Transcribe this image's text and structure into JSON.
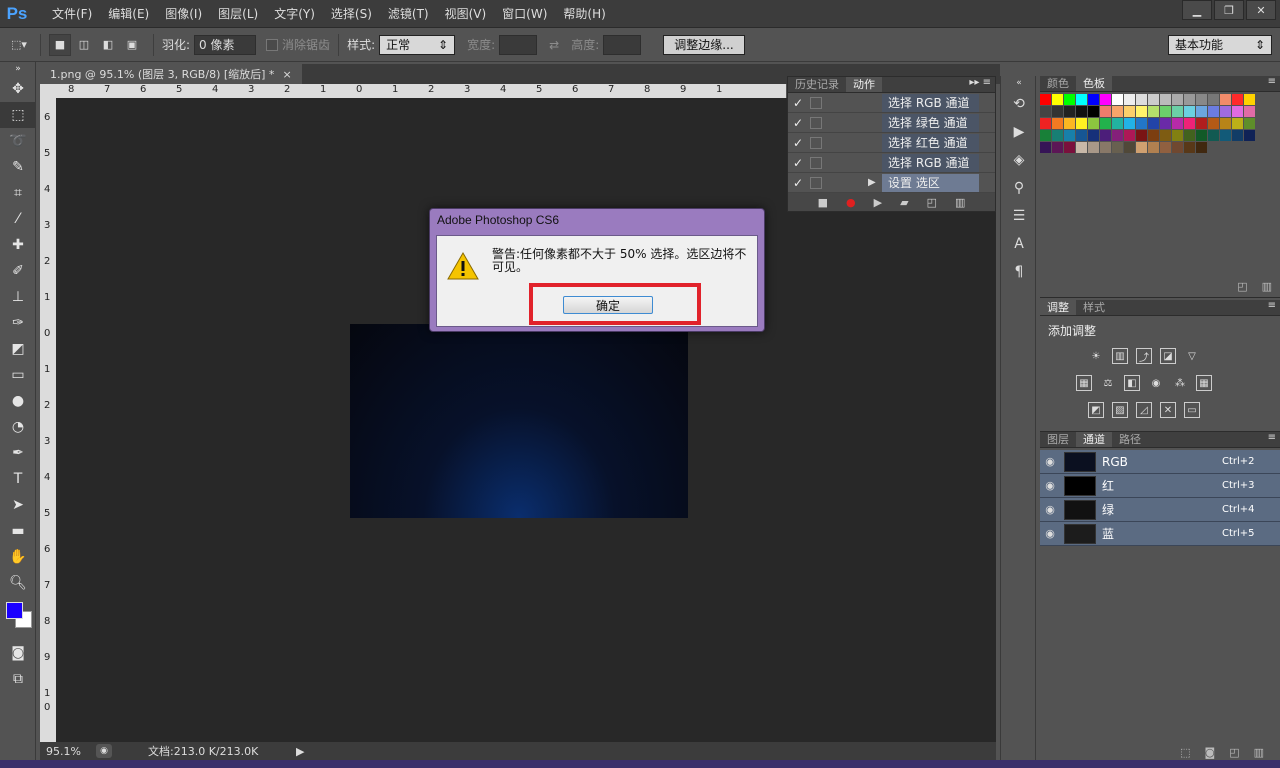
{
  "app": {
    "logo": "Ps"
  },
  "menu": [
    "文件(F)",
    "编辑(E)",
    "图像(I)",
    "图层(L)",
    "文字(Y)",
    "选择(S)",
    "滤镜(T)",
    "视图(V)",
    "窗口(W)",
    "帮助(H)"
  ],
  "window_controls": {
    "minimize": "▁",
    "restore": "❐",
    "close": "✕"
  },
  "options": {
    "feather_label": "羽化:",
    "feather_value": "0 像素",
    "antialias_label": "消除锯齿",
    "style_label": "样式:",
    "style_value": "正常",
    "width_label": "宽度:",
    "height_label": "高度:",
    "refine_edge": "调整边缘...",
    "workspace": "基本功能"
  },
  "document": {
    "tab_title": "1.png @ 95.1% (图层 3, RGB/8) [缩放后] *",
    "tab_close": "×",
    "zoom": "95.1%",
    "doc_size": "文档:213.0 K/213.0K"
  },
  "ruler_top": [
    "8",
    "7",
    "6",
    "5",
    "4",
    "3",
    "2",
    "1",
    "0",
    "1",
    "2",
    "3",
    "4",
    "5",
    "6",
    "7",
    "8",
    "9",
    "1"
  ],
  "ruler_left": [
    "6",
    "5",
    "4",
    "3",
    "2",
    "1",
    "0",
    "1",
    "2",
    "3",
    "4",
    "5",
    "6",
    "7",
    "8",
    "9",
    "1",
    "0"
  ],
  "actions_panel": {
    "tabs": [
      "历史记录",
      "动作"
    ],
    "rows": [
      {
        "check": "✓",
        "label": "选择 RGB 通道",
        "current": false,
        "expand": ""
      },
      {
        "check": "✓",
        "label": "选择 绿色 通道",
        "current": false,
        "expand": ""
      },
      {
        "check": "✓",
        "label": "选择 红色 通道",
        "current": false,
        "expand": ""
      },
      {
        "check": "✓",
        "label": "选择 RGB 通道",
        "current": false,
        "expand": ""
      },
      {
        "check": "✓",
        "label": "设置 选区",
        "current": true,
        "expand": "▶"
      }
    ]
  },
  "swatches_panel": {
    "tabs": [
      "颜色",
      "色板"
    ]
  },
  "adjustments_panel": {
    "tabs": [
      "调整",
      "样式"
    ],
    "title": "添加调整"
  },
  "channels_panel": {
    "tabs": [
      "图层",
      "通道",
      "路径"
    ],
    "rows": [
      {
        "name": "RGB",
        "shortcut": "Ctrl+2"
      },
      {
        "name": "红",
        "shortcut": "Ctrl+3"
      },
      {
        "name": "绿",
        "shortcut": "Ctrl+4"
      },
      {
        "name": "蓝",
        "shortcut": "Ctrl+5"
      }
    ]
  },
  "dialog": {
    "title": "Adobe Photoshop CS6",
    "message": "警告:任何像素都不大于 50% 选择。选区边将不可见。",
    "ok": "确定"
  },
  "colors": {
    "accent": "#4ba3ff",
    "foreground": "#1a00ff",
    "background": "#ffffff",
    "highlight": "#e1222b"
  }
}
